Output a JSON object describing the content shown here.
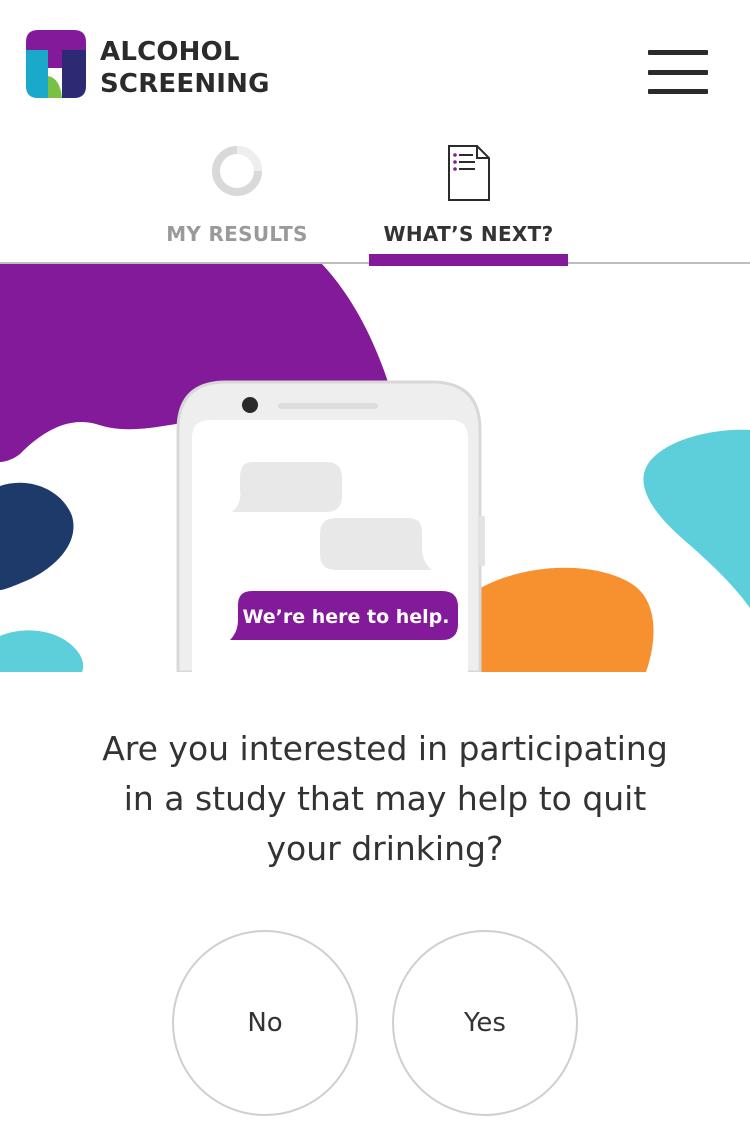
{
  "header": {
    "logo_line1": "ALCOHOL",
    "logo_line2": "SCREENING",
    "menu_icon": "hamburger-menu-icon"
  },
  "tabs": [
    {
      "label": "MY RESULTS",
      "icon": "loading-ring-icon",
      "active": false
    },
    {
      "label": "WHAT’S NEXT?",
      "icon": "document-list-icon",
      "active": true
    }
  ],
  "hero": {
    "bubble_text": "We’re here to help."
  },
  "question": {
    "line1": "Are you interested in participating",
    "line2": "in a study that may help to quit",
    "line3": "your drinking?"
  },
  "answers": {
    "no": "No",
    "yes": "Yes"
  },
  "colors": {
    "purple": "#821a99",
    "navy": "#1e3a6b",
    "teal": "#5ccfda",
    "orange": "#f7912f",
    "green": "#7ac142",
    "text": "#333333"
  }
}
